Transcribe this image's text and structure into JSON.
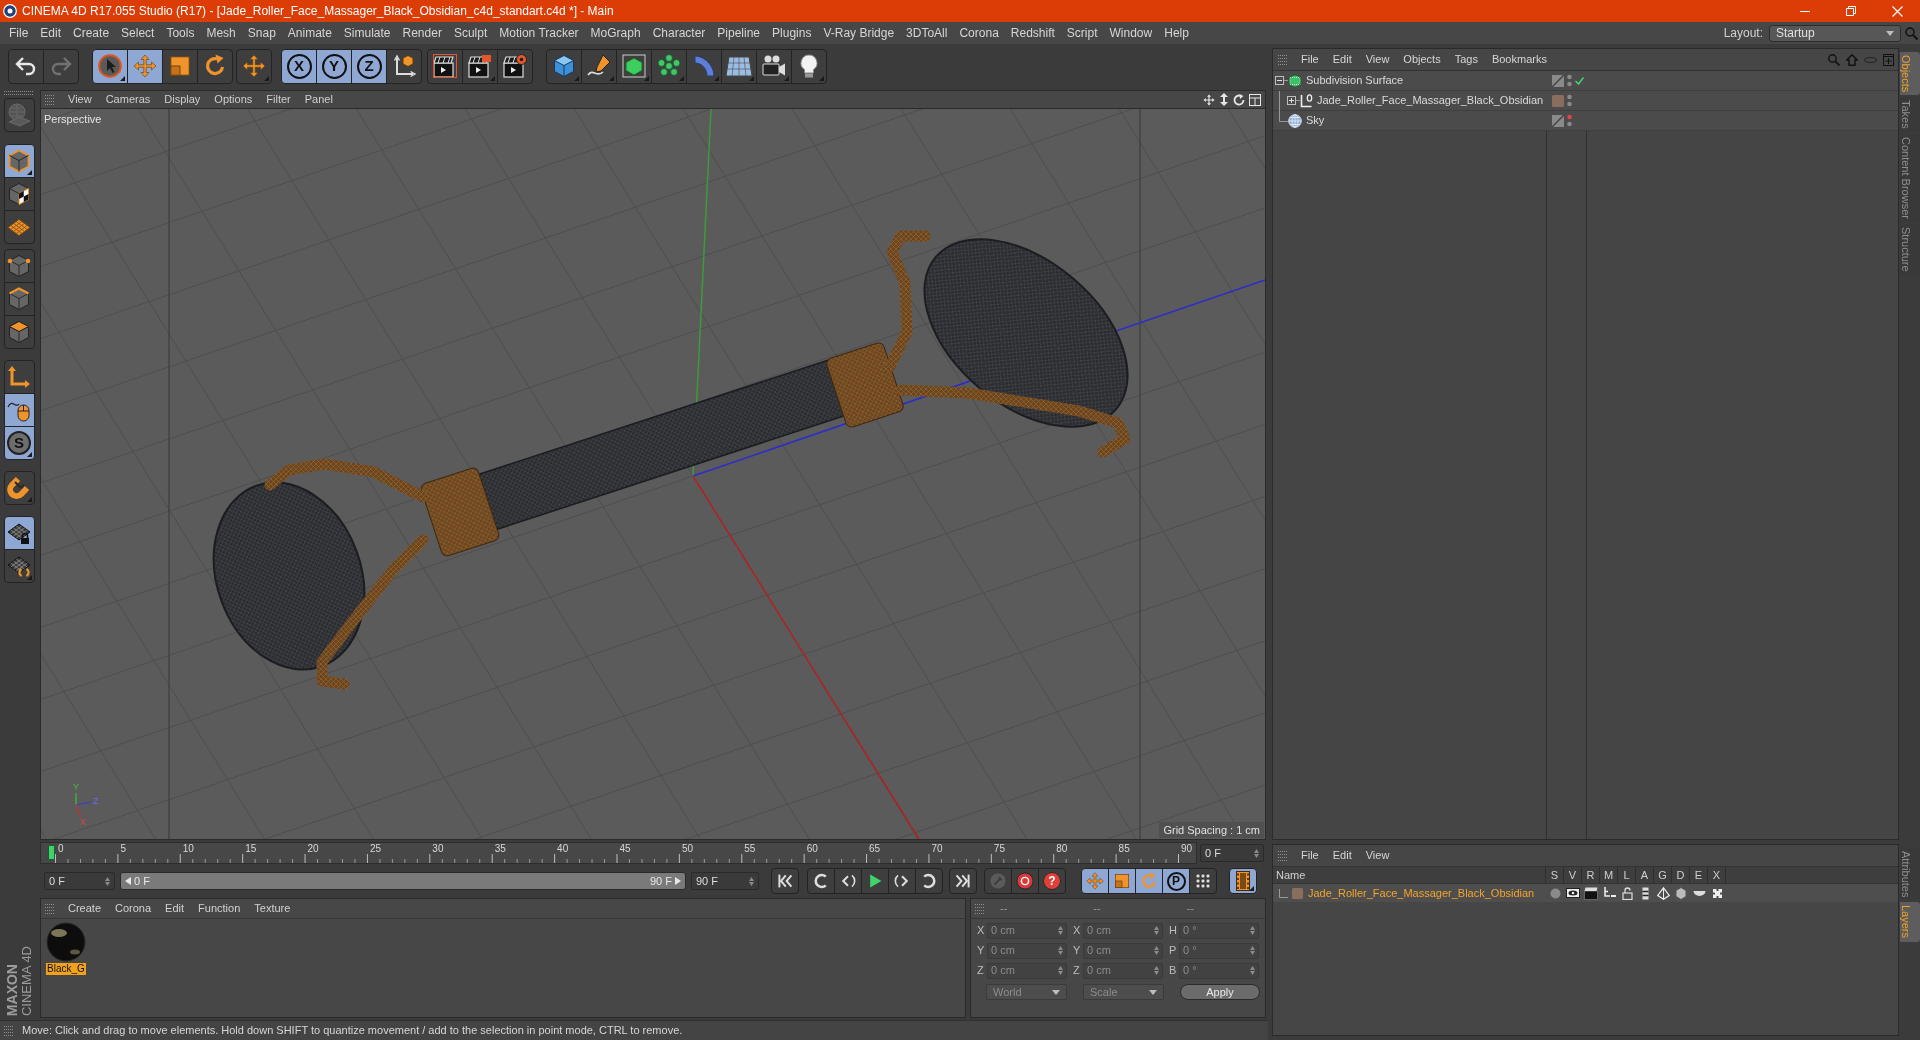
{
  "window": {
    "title": "CINEMA 4D R17.055 Studio (R17) - [Jade_Roller_Face_Massager_Black_Obsidian_c4d_standart.c4d *] - Main"
  },
  "menu_bar": [
    "File",
    "Edit",
    "Create",
    "Select",
    "Tools",
    "Mesh",
    "Snap",
    "Animate",
    "Simulate",
    "Render",
    "Sculpt",
    "Motion Tracker",
    "MoGraph",
    "Character",
    "Pipeline",
    "Plugins",
    "V-Ray Bridge",
    "3DToAll",
    "Corona",
    "Redshift",
    "Script",
    "Window",
    "Help"
  ],
  "layout": {
    "label": "Layout:",
    "value": "Startup"
  },
  "toolbar": [
    {
      "active": false,
      "disabled": false
    },
    {
      "active": false,
      "disabled": true
    },
    {
      "active": true,
      "disabled": false
    },
    {
      "active": true,
      "disabled": false
    },
    {
      "active": false,
      "disabled": false
    },
    {
      "active": false,
      "disabled": false
    },
    {
      "active": false,
      "disabled": false
    },
    {
      "label": "X",
      "active": true,
      "disabled": false
    },
    {
      "label": "Y",
      "active": true,
      "disabled": false
    },
    {
      "label": "Z",
      "active": true,
      "disabled": false
    },
    {
      "active": false,
      "disabled": false
    },
    {
      "active": false,
      "disabled": false
    },
    {
      "active": false,
      "disabled": false
    },
    {
      "active": false,
      "disabled": false
    },
    {
      "active": false,
      "disabled": false
    },
    {
      "active": false,
      "disabled": false
    },
    {
      "active": false,
      "disabled": false
    },
    {
      "active": false,
      "disabled": false
    },
    {
      "active": false,
      "disabled": false
    },
    {
      "active": false,
      "disabled": false
    },
    {
      "active": false,
      "disabled": false
    },
    {
      "active": false,
      "disabled": false
    }
  ],
  "left_toolbar": [
    {
      "active": false,
      "disabled": true
    },
    {
      "active": true,
      "disabled": false
    },
    {
      "active": false,
      "disabled": false
    },
    {
      "active": false,
      "disabled": false
    },
    {
      "active": false,
      "disabled": false
    },
    {
      "active": false,
      "disabled": false
    },
    {
      "active": false,
      "disabled": false
    },
    {
      "active": false,
      "disabled": false
    },
    {
      "active": true,
      "disabled": false
    },
    {
      "label": "S",
      "active": true,
      "disabled": false
    },
    {
      "active": false,
      "disabled": false
    },
    {
      "active": true,
      "disabled": false
    },
    {
      "active": false,
      "disabled": false
    }
  ],
  "viewport": {
    "menu": [
      "View",
      "Cameras",
      "Display",
      "Options",
      "Filter",
      "Panel"
    ],
    "camera": "Perspective",
    "grid_spacing": "Grid Spacing : 1 cm",
    "axis_labels": [
      "Y",
      "Z",
      "X"
    ]
  },
  "timeline": {
    "ticks": [
      "0",
      "5",
      "10",
      "15",
      "20",
      "25",
      "30",
      "35",
      "40",
      "45",
      "50",
      "55",
      "60",
      "65",
      "70",
      "75",
      "80",
      "85",
      "90"
    ],
    "level": 0,
    "current": "0 F"
  },
  "playback": {
    "start": "0 F",
    "range_start": "0 F",
    "range_end": "90 F",
    "end": "90 F",
    "buttons": [
      {
        "active": false,
        "disabled": false
      },
      {
        "active": false,
        "disabled": false
      },
      {
        "active": false,
        "disabled": false
      },
      {
        "active": false,
        "disabled": false
      },
      {
        "active": false,
        "disabled": false
      },
      {
        "active": false,
        "disabled": false
      },
      {
        "active": false,
        "disabled": false
      },
      {
        "active": false,
        "disabled": true
      },
      {
        "active": false,
        "disabled": false
      },
      {
        "label": "?",
        "active": false,
        "disabled": false
      },
      {
        "active": true,
        "disabled": false
      },
      {
        "active": true,
        "disabled": false
      },
      {
        "active": true,
        "disabled": false
      },
      {
        "label": "P",
        "active": true,
        "disabled": false
      },
      {
        "active": false,
        "disabled": false
      },
      {
        "active": true,
        "disabled": false
      }
    ]
  },
  "materials_panel": {
    "menu": [
      "Create",
      "Corona",
      "Edit",
      "Function",
      "Texture"
    ],
    "materials": [
      {
        "name": "Black_G",
        "selected": true
      }
    ]
  },
  "coordinates": {
    "disabled": true,
    "headers": [
      "--",
      "--",
      "--"
    ],
    "rows": [
      {
        "fields": [
          {
            "label": "X",
            "value": "0 cm"
          },
          {
            "label": "X",
            "value": "0 cm"
          },
          {
            "label": "H",
            "value": "0 °"
          }
        ]
      },
      {
        "fields": [
          {
            "label": "Y",
            "value": "0 cm"
          },
          {
            "label": "Y",
            "value": "0 cm"
          },
          {
            "label": "P",
            "value": "0 °"
          }
        ]
      },
      {
        "fields": [
          {
            "label": "Z",
            "value": "0 cm"
          },
          {
            "label": "Z",
            "value": "0 cm"
          },
          {
            "label": "B",
            "value": "0 °"
          }
        ]
      }
    ],
    "dropdowns": [
      "World",
      "Scale"
    ],
    "apply": "Apply"
  },
  "status_bar": "Move: Click and drag to move elements. Hold down SHIFT to quantize movement / add to the selection in point mode, CTRL to remove.",
  "logo": {
    "brand": "MAXON",
    "product": "CINEMA 4D"
  },
  "objects_panel": {
    "menu": [
      "File",
      "Edit",
      "View",
      "Objects",
      "Tags",
      "Bookmarks"
    ],
    "tree": [
      {
        "name": "Subdivision Surface",
        "kind": "subdivision",
        "expanded": true,
        "editor_off": false,
        "enabled": true,
        "children": [
          {
            "name": "Jade_Roller_Face_Massager_Black_Obsidian",
            "kind": "null",
            "expanded": false,
            "editor_off": false,
            "color": "#8a6e5c"
          }
        ]
      },
      {
        "name": "Sky",
        "kind": "sky",
        "editor_off": true
      }
    ]
  },
  "side_tabs_top": [
    {
      "label": "Objects",
      "selected": true
    },
    {
      "label": "Takes",
      "selected": false
    },
    {
      "label": "Content Browser",
      "selected": false
    },
    {
      "label": "Structure",
      "selected": false
    }
  ],
  "layers_panel": {
    "menu": [
      "File",
      "Edit",
      "View"
    ],
    "columns": [
      "Name",
      "S",
      "V",
      "R",
      "M",
      "L",
      "A",
      "G",
      "D",
      "E",
      "X"
    ],
    "rows": [
      {
        "name": "Jade_Roller_Face_Massager_Black_Obsidian",
        "color": "#8a6e5c",
        "selected": true
      }
    ]
  },
  "side_tabs_bottom": [
    {
      "label": "Attributes",
      "selected": false
    },
    {
      "label": "Layers",
      "selected": true
    }
  ]
}
